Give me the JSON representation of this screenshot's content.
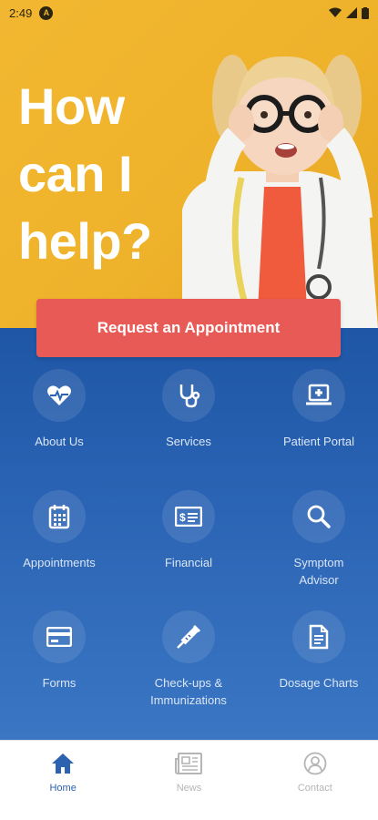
{
  "status_bar": {
    "time": "2:49",
    "app_badge": "A"
  },
  "hero": {
    "title": "How can I help?"
  },
  "cta": {
    "label": "Request an Appointment"
  },
  "tiles": [
    {
      "label": "About Us",
      "icon": "heart-pulse-icon"
    },
    {
      "label": "Services",
      "icon": "stethoscope-icon"
    },
    {
      "label": "Patient Portal",
      "icon": "laptop-medical-icon"
    },
    {
      "label": "Appointments",
      "icon": "calendar-icon"
    },
    {
      "label": "Financial",
      "icon": "bill-icon"
    },
    {
      "label": "Symptom Advisor",
      "icon": "search-icon"
    },
    {
      "label": "Forms",
      "icon": "credit-card-icon"
    },
    {
      "label": "Check-ups & Immunizations",
      "icon": "syringe-icon"
    },
    {
      "label": "Dosage Charts",
      "icon": "document-icon"
    }
  ],
  "nav": [
    {
      "label": "Home",
      "icon": "home-icon",
      "active": true
    },
    {
      "label": "News",
      "icon": "newspaper-icon",
      "active": false
    },
    {
      "label": "Contact",
      "icon": "person-icon",
      "active": false
    }
  ],
  "colors": {
    "hero_bg": "#f2b730",
    "blue": "#2a63b3",
    "cta": "#e85a55",
    "nav_active": "#2d62b0"
  }
}
